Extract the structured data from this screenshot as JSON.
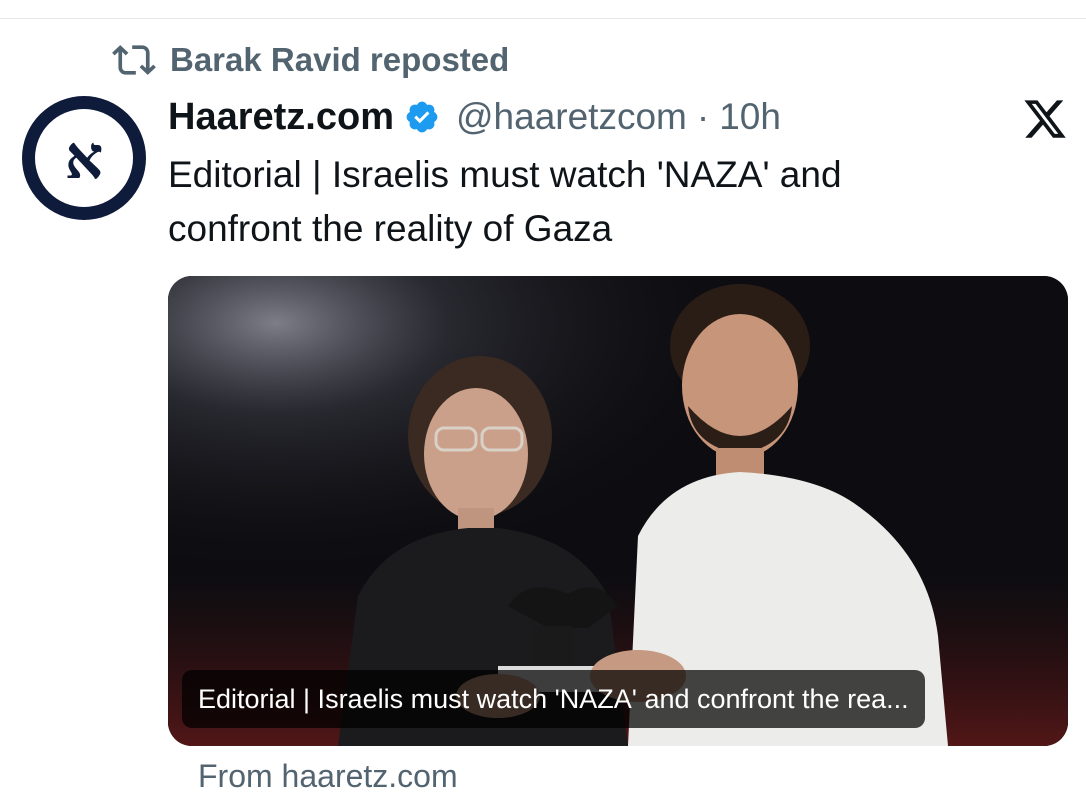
{
  "repost": {
    "icon": "repost-icon",
    "label": "Barak Ravid reposted"
  },
  "author": {
    "display_name": "Haaretz.com",
    "verified": true,
    "handle": "@haaretzcom",
    "separator": "·",
    "time": "10h",
    "avatar_glyph": "א"
  },
  "tweet": {
    "text_line1": "Editorial | Israelis must watch 'NAZA' and",
    "text_line2": "confront the reality of Gaza"
  },
  "media": {
    "type": "photo",
    "caption": "Editorial | Israelis must watch 'NAZA' and confront the rea..."
  },
  "link_source": "From haaretz.com",
  "brand": {
    "platform_icon": "x-logo-icon",
    "verified_color": "#1d9bf0",
    "muted_color": "#536471"
  }
}
